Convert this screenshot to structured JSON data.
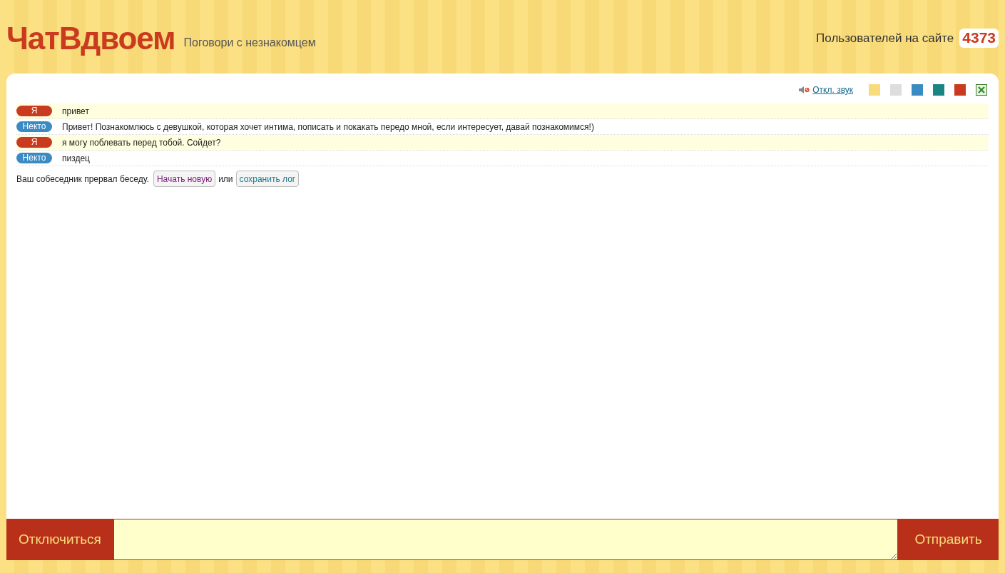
{
  "header": {
    "logo": "ЧатВдвоем",
    "tagline": "Поговори с незнакомцем",
    "users_label": "Пользователей на сайте",
    "users_count": "4373"
  },
  "toolbar": {
    "sound_link": "Откл. звук",
    "themes": [
      {
        "color": "#f8dc7c"
      },
      {
        "color": "#dddddd"
      },
      {
        "color": "#3a8ac4"
      },
      {
        "color": "#1a8585"
      },
      {
        "color": "#c93a1e"
      }
    ]
  },
  "messages": [
    {
      "kind": "me",
      "author": "Я",
      "text": "привет"
    },
    {
      "kind": "stranger",
      "author": "Некто",
      "text": "Привет! Познакомлюсь с девушкой, которая хочет интима, пописать и покакать передо мной, если интересует, давай познакомимся!)"
    },
    {
      "kind": "me",
      "author": "Я",
      "text": "я могу поблевать перед тобой. Сойдет?"
    },
    {
      "kind": "stranger",
      "author": "Некто",
      "text": "пиздец"
    }
  ],
  "status": {
    "text": "Ваш собеседник прервал беседу.",
    "new_button": "Начать новую",
    "or": "или",
    "save_button": "сохранить лог"
  },
  "footer": {
    "disconnect_button": "Отключиться",
    "send_button": "Отправить"
  }
}
